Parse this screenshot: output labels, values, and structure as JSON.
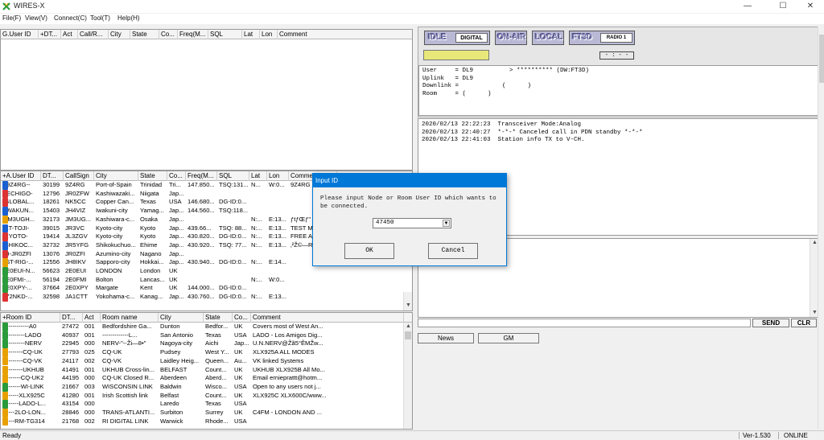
{
  "window": {
    "title": "WIRES-X",
    "minimize": "—",
    "maximize": "☐",
    "close": "✕"
  },
  "menu": [
    "File(F)",
    "View(V)",
    "Connect(C)",
    "Tool(T)",
    "Help(H)"
  ],
  "top_table": {
    "columns": [
      "G.User ID",
      "+DT...",
      "Act",
      "Call/R...",
      "City",
      "State",
      "Co...",
      "Freq(M...",
      "SQL",
      "Lat",
      "Lon",
      "Comment"
    ]
  },
  "nodes_table": {
    "columns": [
      "+A.User ID",
      "DT...",
      "CallSign",
      "City",
      "State",
      "Co...",
      "Freq(M...",
      "SQL",
      "Lat",
      "Lon",
      "Comment"
    ],
    "rows": [
      {
        "icon": "A",
        "color": "#1a5fd0",
        "cells": [
          "--9Z4RG--",
          "30199",
          "9Z4RG",
          "Port-of-Spain",
          "Trinidad",
          "Tri...",
          "147.850...",
          "TSQ:131...",
          "N...",
          "W:0...",
          "9Z4RG"
        ]
      },
      {
        "icon": "R",
        "color": "#d33",
        "cells": [
          "--ECHIGO-",
          "12796",
          "JR0ZFW",
          "Kashiwazaki...",
          "Niigata",
          "Jap...",
          "",
          "",
          "",
          "",
          ""
        ]
      },
      {
        "icon": "R",
        "color": "#d33",
        "cells": [
          "-GLOBAL...",
          "18261",
          "NK5CC",
          "Copper Can...",
          "Texas",
          "USA",
          "146.680...",
          "DG-ID:0...",
          "",
          "",
          ""
        ]
      },
      {
        "icon": "A",
        "color": "#1a5fd0",
        "cells": [
          "-IWAKUN...",
          "15403",
          "JH4VIZ",
          "Iwakuni-city",
          "Yamag...",
          "Jap...",
          "144.560...",
          "TSQ:118...",
          "",
          "",
          ""
        ]
      },
      {
        "icon": "W",
        "color": "#e8a000",
        "cells": [
          "-JM3UGH...",
          "32173",
          "JM3UG...",
          "Kashiwara-c...",
          "Osaka",
          "Jap...",
          "",
          "",
          "N:...",
          "E:13...",
          "ƒtƒŒƒ\""
        ]
      },
      {
        "icon": "A",
        "color": "#1a5fd0",
        "cells": [
          "-KT-TOJI-",
          "39015",
          "JR3VC",
          "Kyoto-city",
          "Kyoto",
          "Jap...",
          "439.66...",
          "TSQ: 88...",
          "N:...",
          "E:13...",
          "TEST M"
        ]
      },
      {
        "icon": "R",
        "color": "#d33",
        "cells": [
          "-KYOTO-",
          "19414",
          "JL3ZGV",
          "Kyoto-city",
          "Kyoto",
          "Jap...",
          "430.820...",
          "DG-ID:0...",
          "N:...",
          "E:13...",
          "FREE A"
        ]
      },
      {
        "icon": "A",
        "color": "#1a5fd0",
        "cells": [
          "-SHIKOC...",
          "32732",
          "JR5YFG",
          "Shikokuchuo...",
          "Ehime",
          "Jap...",
          "430.920...",
          "TSQ: 77...",
          "N:...",
          "E:13...",
          "‚²Ž©—R"
        ]
      },
      {
        "icon": "R",
        "color": "#d33",
        "cells": [
          "09-JR0ZFI",
          "13076",
          "JR0ZFI",
          "Azumino-city",
          "Nagano",
          "Jap...",
          "",
          "",
          "",
          "",
          ""
        ]
      },
      {
        "icon": "W",
        "color": "#e8a000",
        "cells": [
          "1ST-RIG-...",
          "12556",
          "JH8IKV",
          "Sapporo-city",
          "Hokkai...",
          "Jap...",
          "430.940...",
          "DG-ID:0...",
          "N:...",
          "E:14...",
          ""
        ]
      },
      {
        "icon": "W",
        "color": "#2a9a3a",
        "cells": [
          "2E0EUI-N...",
          "56623",
          "2E0EUI",
          "LONDON",
          "London",
          "UK",
          "",
          "",
          "",
          "",
          ""
        ]
      },
      {
        "icon": "W",
        "color": "#2a9a3a",
        "cells": [
          "2E0FMI-...",
          "56194",
          "2E0FMI",
          "Bolton",
          "Lancas...",
          "UK",
          "",
          "",
          "N:...",
          "W:0...",
          ""
        ]
      },
      {
        "icon": "W",
        "color": "#2a9a3a",
        "cells": [
          "2E0XPY-...",
          "37664",
          "2E0XPY",
          "Margate",
          "Kent",
          "UK",
          "144.000...",
          "DG-ID:0...",
          "",
          "",
          ""
        ]
      },
      {
        "icon": "R",
        "color": "#d33",
        "cells": [
          "472NKD-...",
          "32598",
          "JA1CTT",
          "Yokohama-c...",
          "Kanag...",
          "Jap...",
          "430.760...",
          "DG-ID:0...",
          "N:...",
          "E:13...",
          ""
        ]
      }
    ]
  },
  "rooms_table": {
    "columns": [
      "+Room ID",
      "DT...",
      "Act",
      "Room name",
      "City",
      "State",
      "Co...",
      "Comment"
    ],
    "rows": [
      {
        "color": "#2a9a3a",
        "cells": [
          "-------------A0",
          "27472",
          "001",
          "Bedfordshire Ga...",
          "Dunton",
          "Bedfor...",
          "UK",
          "Covers most of West An..."
        ]
      },
      {
        "color": "#2a9a3a",
        "cells": [
          "-----------LADO",
          "40937",
          "001",
          "-------------L...",
          "San Antonio",
          "Texas",
          "USA",
          "LADO - Los Amigos Dig..."
        ]
      },
      {
        "color": "#2a9a3a",
        "cells": [
          "-----------NERV",
          "22945",
          "000",
          "NERV-\"--Ži—8•\"",
          "Nagoya-city",
          "Aichi",
          "Jap...",
          "U.N.NERV@Žã5°ÊMŽw..."
        ]
      },
      {
        "color": "#e8a000",
        "cells": [
          "----------CQ-UK",
          "27793",
          "025",
          "CQ-UK",
          "Pudsey",
          "West Y...",
          "UK",
          "XLX925A ALL MODES"
        ]
      },
      {
        "color": "#e8a000",
        "cells": [
          "----------CQ-VK",
          "24117",
          "002",
          "CQ-VK",
          "Laidley Heig...",
          "Queen...",
          "Au...",
          "VK linked Systems"
        ]
      },
      {
        "color": "#e8a000",
        "cells": [
          "----------UKHUB",
          "41491",
          "001",
          "UKHUB Cross-lin...",
          "BELFAST",
          "Count...",
          "UK",
          "UKHUB XLX925B All Mo..."
        ]
      },
      {
        "color": "#e8a000",
        "cells": [
          "---------CQ-UK2",
          "44195",
          "000",
          "CQ-UK Closed R...",
          "Aberdeen",
          "Aberd...",
          "UK",
          "Email ernieprattt@hotm..."
        ]
      },
      {
        "color": "#2a9a3a",
        "cells": [
          "---------WI-LINK",
          "21667",
          "003",
          "WISCONSIN LINK",
          "Baldwin",
          "Wisco...",
          "USA",
          "Open to any users not j..."
        ]
      },
      {
        "color": "#e8a000",
        "cells": [
          "--------XLX925C",
          "41280",
          "001",
          "Irish Scottish link",
          "Belfast",
          "Count...",
          "UK",
          "XLX925C XLX600C/www..."
        ]
      },
      {
        "color": "#2a9a3a",
        "cells": [
          "--------LADO-L...",
          "43154",
          "000",
          "",
          "Laredo",
          "Texas",
          "USA",
          ""
        ]
      },
      {
        "color": "#e8a000",
        "cells": [
          "------2LO-LON...",
          "28846",
          "000",
          "TRANS-ATLANTI...",
          "Surbiton",
          "Surrey",
          "UK",
          "C4FM - LONDON AND ..."
        ]
      },
      {
        "color": "#e8a000",
        "cells": [
          "------RM-TG314",
          "21768",
          "002",
          "RI DIGITAL LINK",
          "Warwick",
          "Rhode...",
          "USA",
          ""
        ]
      }
    ]
  },
  "status_panel": {
    "idle": "IDLE",
    "digital": "DIGITAL",
    "onair": "ON-AIR",
    "local": "LOCAL",
    "radio_model": "FT3D",
    "radio_tag": "RADIO 1",
    "timer": "- : - -"
  },
  "info": {
    "lines": [
      "User     = DL9          > ********** (DW:FT3D)",
      "Uplink   = DL9",
      "Downlink =            (      )",
      "Room     = (      )"
    ]
  },
  "log": {
    "lines": [
      "2020/02/13 22:22:23  Transceiver Mode:Analog",
      "2020/02/13 22:40:27  *-*-* Canceled call in PDN standby *-*-*",
      "2020/02/13 22:41:03  Station info TX to V-CH."
    ]
  },
  "chat": {
    "send": "SEND",
    "clear": "CLR",
    "news": "News",
    "gm": "GM"
  },
  "dialog": {
    "title": "Input ID",
    "message": "Please input Node or Room User ID which wants to be connected.",
    "value": "47450",
    "ok": "OK",
    "cancel": "Cancel"
  },
  "statusbar": {
    "left": "Ready",
    "version": "Ver-1.530",
    "state": "ONLINE"
  },
  "colors": {
    "accent": "#0078d7",
    "yellow_field": "#e8e87a",
    "display_bg": "#b9b9d6"
  }
}
